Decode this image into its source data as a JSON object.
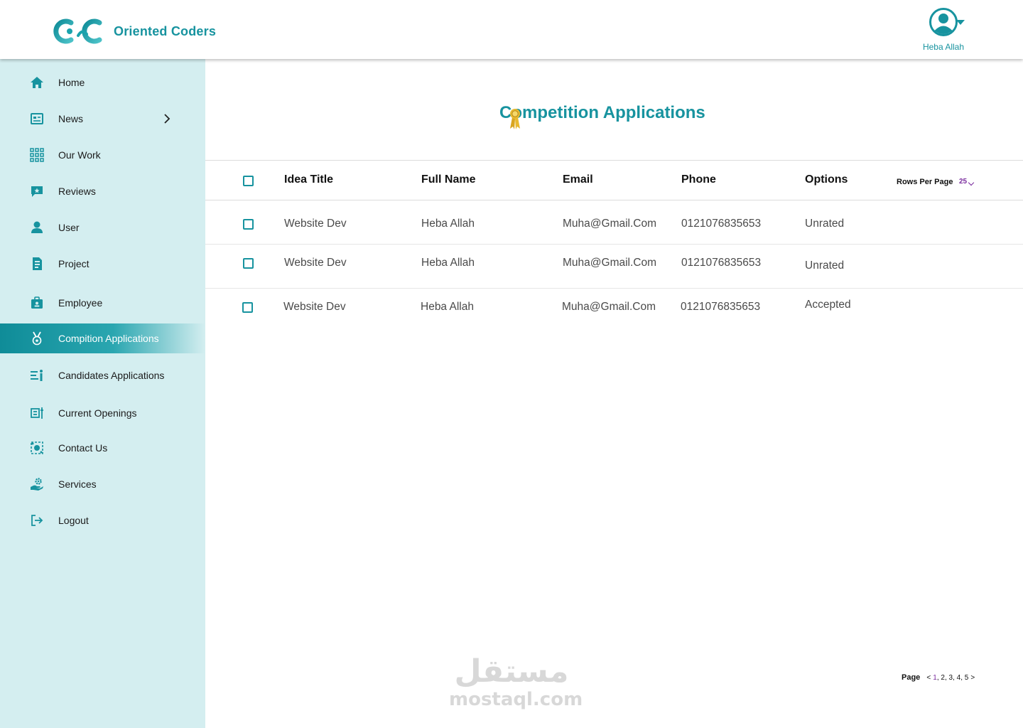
{
  "brand": {
    "name": "Oriented Coders",
    "color": "#17939f"
  },
  "user": {
    "name": "Heba Allah"
  },
  "sidebar": {
    "items": [
      {
        "label": "Home",
        "icon": "home-icon"
      },
      {
        "label": "News",
        "icon": "news-icon",
        "has_submenu": true
      },
      {
        "label": "Our Work",
        "icon": "grid-icon"
      },
      {
        "label": "Reviews",
        "icon": "review-icon"
      },
      {
        "label": "User",
        "icon": "user-icon"
      },
      {
        "label": "Project",
        "icon": "project-icon"
      },
      {
        "label": "Employee",
        "icon": "employee-icon"
      },
      {
        "label": "Compition Applications",
        "icon": "medal-icon",
        "active": true
      },
      {
        "label": "Candidates Applications",
        "icon": "candidates-icon"
      },
      {
        "label": "Current Openings",
        "icon": "openings-icon"
      },
      {
        "label": "Contact Us",
        "icon": "contact-icon"
      },
      {
        "label": "Services",
        "icon": "services-icon"
      },
      {
        "label": "Logout",
        "icon": "logout-icon"
      }
    ]
  },
  "main": {
    "title": "Competition Applications",
    "table": {
      "columns": [
        "Idea Title",
        "Full Name",
        "Email",
        "Phone",
        "Options"
      ],
      "rows": [
        {
          "idea_title": "Website Dev",
          "full_name": "Heba Allah",
          "email": "Muha@Gmail.Com",
          "phone": "0121076835653",
          "option": "Unrated"
        },
        {
          "idea_title": "Website Dev",
          "full_name": "Heba Allah",
          "email": "Muha@Gmail.Com",
          "phone": "0121076835653",
          "option": "Unrated"
        },
        {
          "idea_title": "Website Dev",
          "full_name": "Heba Allah",
          "email": "Muha@Gmail.Com",
          "phone": "0121076835653",
          "option": "Accepted"
        }
      ]
    },
    "rows_per_page": {
      "label": "Rows Per Page",
      "value": "25"
    },
    "pagination": {
      "label": "Page",
      "prev": "<",
      "pages": [
        "1",
        "2",
        "3",
        "4",
        "5"
      ],
      "current": "1",
      "next": ">"
    }
  },
  "watermark": {
    "arabic": "مستقل",
    "latin": "mostaql.com"
  }
}
